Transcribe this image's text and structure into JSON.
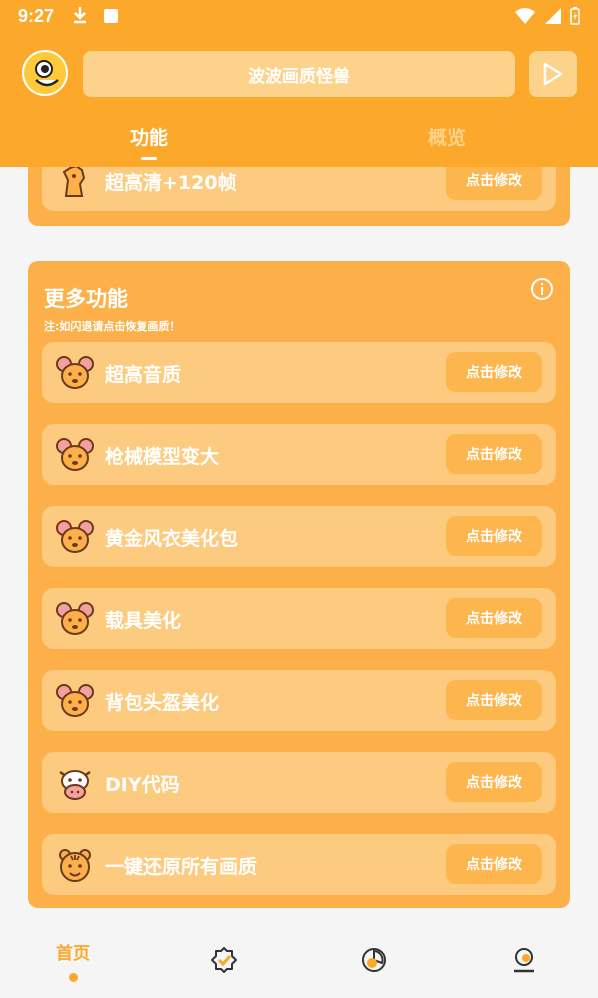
{
  "status": {
    "time": "9:27"
  },
  "header": {
    "title": "波波画质怪兽",
    "tabs": [
      {
        "label": "功能",
        "active": true
      },
      {
        "label": "概览",
        "active": false
      }
    ]
  },
  "top_card": {
    "row": {
      "label": "超高清+120帧",
      "button": "点击修改",
      "icon": "horse-icon"
    }
  },
  "more_card": {
    "title": "更多功能",
    "note": "注:如闪退请点击恢复画质！",
    "rows": [
      {
        "label": "超高音质",
        "button": "点击修改",
        "icon": "mouse-icon"
      },
      {
        "label": "枪械模型变大",
        "button": "点击修改",
        "icon": "mouse-icon"
      },
      {
        "label": "黄金风衣美化包",
        "button": "点击修改",
        "icon": "mouse-icon"
      },
      {
        "label": "载具美化",
        "button": "点击修改",
        "icon": "mouse-icon"
      },
      {
        "label": "背包头盔美化",
        "button": "点击修改",
        "icon": "mouse-icon"
      },
      {
        "label": "DIY代码",
        "button": "点击修改",
        "icon": "cow-icon"
      },
      {
        "label": "一键还原所有画质",
        "button": "点击修改",
        "icon": "tiger-icon"
      }
    ]
  },
  "bottom_nav": {
    "home_label": "首页",
    "items": [
      "home",
      "badge-check-icon",
      "pie-chart-icon",
      "profile-icon"
    ]
  },
  "colors": {
    "accent": "#fca82a",
    "card": "#fdb04a",
    "row": "#fdcb80",
    "button": "#fdb64e"
  }
}
